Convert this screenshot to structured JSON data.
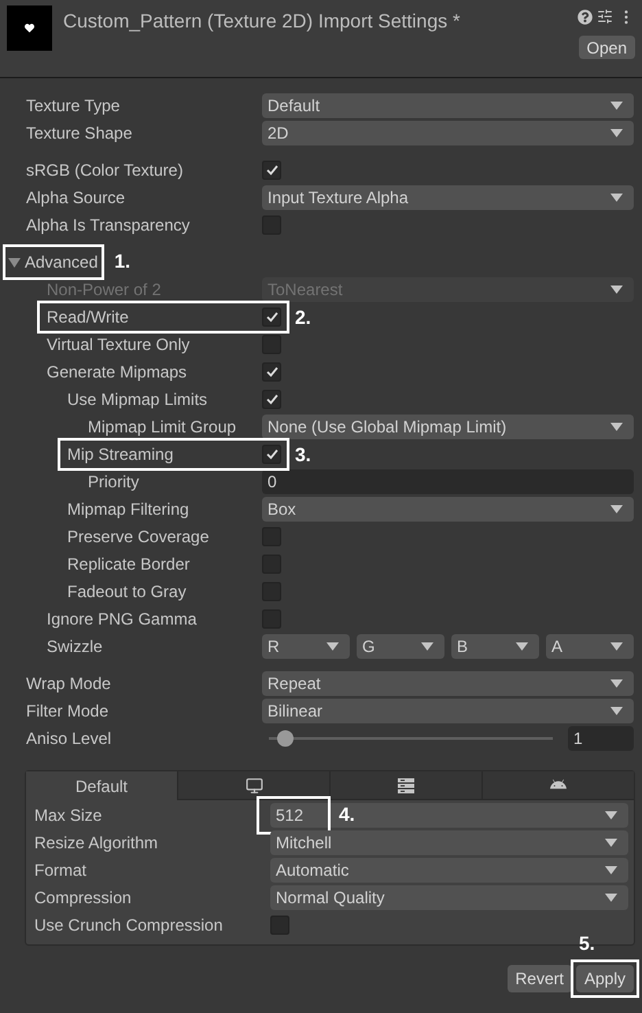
{
  "header": {
    "title": "Custom_Pattern (Texture 2D) Import Settings *",
    "button": "Open"
  },
  "groups": [
    [
      {
        "kind": "dropdown",
        "label": "Texture Type",
        "value": "Default",
        "disabled": false
      },
      {
        "kind": "dropdown",
        "label": "Texture Shape",
        "value": "2D",
        "disabled": false
      }
    ],
    [
      {
        "kind": "checkbox",
        "label": "sRGB (Color Texture)",
        "checked": true
      },
      {
        "kind": "dropdown",
        "label": "Alpha Source",
        "value": "Input Texture Alpha",
        "disabled": false
      },
      {
        "kind": "checkbox",
        "label": "Alpha Is Transparency",
        "checked": false
      }
    ],
    [
      {
        "kind": "foldout",
        "label": "Advanced",
        "expanded": true,
        "annotation": "1.",
        "children": [
          {
            "kind": "dropdown",
            "label": "Non-Power of 2",
            "value": "ToNearest",
            "disabled": true
          },
          {
            "kind": "checkbox",
            "label": "Read/Write",
            "checked": true,
            "annotation": "2."
          },
          {
            "kind": "checkbox",
            "label": "Virtual Texture Only",
            "checked": false
          },
          {
            "kind": "checkbox",
            "label": "Generate Mipmaps",
            "checked": true,
            "children": [
              {
                "kind": "checkbox",
                "label": "Use Mipmap Limits",
                "checked": true,
                "children": [
                  {
                    "kind": "dropdown",
                    "label": "Mipmap Limit Group",
                    "value": "None (Use Global Mipmap Limit)",
                    "disabled": false
                  }
                ]
              },
              {
                "kind": "checkbox",
                "label": "Mip Streaming",
                "checked": true,
                "annotation": "3.",
                "children": [
                  {
                    "kind": "number",
                    "label": "Priority",
                    "value": "0"
                  }
                ]
              },
              {
                "kind": "dropdown",
                "label": "Mipmap Filtering",
                "value": "Box",
                "disabled": false
              },
              {
                "kind": "checkbox",
                "label": "Preserve Coverage",
                "checked": false
              },
              {
                "kind": "checkbox",
                "label": "Replicate Border",
                "checked": false
              },
              {
                "kind": "checkbox",
                "label": "Fadeout to Gray",
                "checked": false
              }
            ]
          },
          {
            "kind": "checkbox",
            "label": "Ignore PNG Gamma",
            "checked": false
          },
          {
            "kind": "swizzle",
            "label": "Swizzle",
            "channels": [
              "R",
              "G",
              "B",
              "A"
            ]
          }
        ]
      }
    ],
    [
      {
        "kind": "dropdown",
        "label": "Wrap Mode",
        "value": "Repeat",
        "disabled": false
      },
      {
        "kind": "dropdown",
        "label": "Filter Mode",
        "value": "Bilinear",
        "disabled": false
      },
      {
        "kind": "slider",
        "label": "Aniso Level",
        "level": 0.06,
        "value": "1"
      }
    ]
  ],
  "platform": {
    "tabs": [
      {
        "label": "Default",
        "selected": true
      },
      {
        "selected": false
      },
      {
        "selected": false
      },
      {
        "selected": false
      }
    ],
    "rows": [
      {
        "kind": "dropdown",
        "label": "Max Size",
        "value": "512",
        "disabled": false,
        "annotation": "4."
      },
      {
        "kind": "dropdown",
        "label": "Resize Algorithm",
        "value": "Mitchell",
        "disabled": false
      },
      {
        "kind": "dropdown",
        "label": "Format",
        "value": "Automatic",
        "disabled": false
      },
      {
        "kind": "dropdown",
        "label": "Compression",
        "value": "Normal Quality",
        "disabled": false
      },
      {
        "kind": "checkbox",
        "label": "Use Crunch Compression",
        "checked": false
      }
    ]
  },
  "buttons": [
    {
      "label": "Revert"
    },
    {
      "label": "Apply",
      "annotation": "5."
    }
  ]
}
